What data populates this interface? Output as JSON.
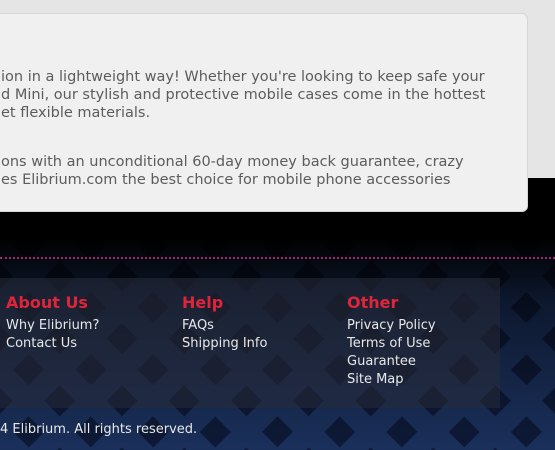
{
  "content": {
    "paragraph1_lines": [
      "ion in a lightweight way! Whether you're looking to keep safe your",
      "d Mini, our stylish and protective mobile cases come in the hottest",
      "et flexible materials."
    ],
    "paragraph2_lines": [
      "ons with an unconditional 60-day money back guarantee, crazy",
      "es Elibrium.com the best choice for mobile phone accessories"
    ]
  },
  "footer": {
    "about": {
      "heading": "About Us",
      "links": [
        "Why Elibrium?",
        "Contact Us"
      ]
    },
    "help": {
      "heading": "Help",
      "links": [
        "FAQs",
        "Shipping Info"
      ]
    },
    "other": {
      "heading": "Other",
      "links": [
        "Privacy Policy",
        "Terms of Use",
        "Guarantee",
        "Site Map"
      ]
    },
    "copyright": "4 Elibrium. All rights reserved."
  },
  "colors": {
    "heading_red": "#e0243a",
    "footer_dark": "#0b1430",
    "dotted_rule": "#a32b6a"
  }
}
